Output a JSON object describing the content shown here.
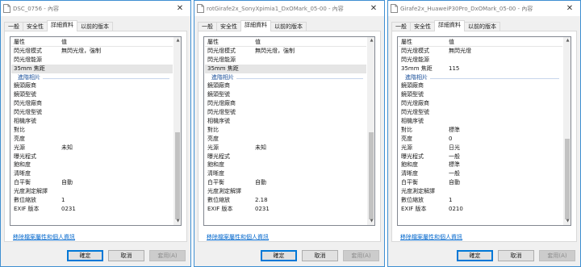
{
  "windows": [
    {
      "title": "DSC_0756 - 內容",
      "tabs": [
        "一般",
        "安全性",
        "詳細資料",
        "以前的版本"
      ],
      "active_tab": 2,
      "columns": [
        "屬性",
        "值"
      ],
      "rows_before_group": [
        {
          "k": "閃光燈模式",
          "v": "無閃光燈，強制"
        },
        {
          "k": "閃光燈能源",
          "v": ""
        },
        {
          "k": "35mm 焦距",
          "v": ""
        }
      ],
      "selected_row": 2,
      "group_label": "進階相片",
      "rows_after_group": [
        {
          "k": "鏡頭廠商",
          "v": ""
        },
        {
          "k": "鏡頭型號",
          "v": ""
        },
        {
          "k": "閃光燈廠商",
          "v": ""
        },
        {
          "k": "閃光燈型號",
          "v": ""
        },
        {
          "k": "相機序號",
          "v": ""
        },
        {
          "k": "對比",
          "v": ""
        },
        {
          "k": "亮度",
          "v": ""
        },
        {
          "k": "光源",
          "v": "未知"
        },
        {
          "k": "曝光程式",
          "v": ""
        },
        {
          "k": "飽和度",
          "v": ""
        },
        {
          "k": "清晰度",
          "v": ""
        },
        {
          "k": "白平衡",
          "v": "自動"
        },
        {
          "k": "光度測定解譯",
          "v": ""
        },
        {
          "k": "數位縮放",
          "v": "1"
        },
        {
          "k": "EXIF 版本",
          "v": "0231"
        }
      ],
      "link": "移除檔案屬性和個人資訊",
      "buttons": {
        "ok": "確定",
        "cancel": "取消",
        "apply": "套用(A)"
      }
    },
    {
      "title": "rotGirafe2x_SonyXpimia1_DxOMark_05-00 - 內容",
      "tabs": [
        "一般",
        "安全性",
        "詳細資料",
        "以前的版本"
      ],
      "active_tab": 2,
      "columns": [
        "屬性",
        "值"
      ],
      "rows_before_group": [
        {
          "k": "閃光燈模式",
          "v": "無閃光燈，強制"
        },
        {
          "k": "閃光燈能源",
          "v": ""
        },
        {
          "k": "35mm 焦距",
          "v": ""
        }
      ],
      "selected_row": 2,
      "group_label": "進階相片",
      "rows_after_group": [
        {
          "k": "鏡頭廠商",
          "v": ""
        },
        {
          "k": "鏡頭型號",
          "v": ""
        },
        {
          "k": "閃光燈廠商",
          "v": ""
        },
        {
          "k": "閃光燈型號",
          "v": ""
        },
        {
          "k": "相機序號",
          "v": ""
        },
        {
          "k": "對比",
          "v": ""
        },
        {
          "k": "亮度",
          "v": ""
        },
        {
          "k": "光源",
          "v": "未知"
        },
        {
          "k": "曝光程式",
          "v": ""
        },
        {
          "k": "飽和度",
          "v": ""
        },
        {
          "k": "清晰度",
          "v": ""
        },
        {
          "k": "白平衡",
          "v": "自動"
        },
        {
          "k": "光度測定解譯",
          "v": ""
        },
        {
          "k": "數位縮放",
          "v": "2.18"
        },
        {
          "k": "EXIF 版本",
          "v": "0231"
        }
      ],
      "link": "移除檔案屬性和個人資訊",
      "buttons": {
        "ok": "確定",
        "cancel": "取消",
        "apply": "套用(A)"
      }
    },
    {
      "title": "Girafe2x_HuaweiP30Pro_DxOMark_05-00 - 內容",
      "tabs": [
        "一般",
        "安全性",
        "詳細資料",
        "以前的版本"
      ],
      "active_tab": 2,
      "columns": [
        "屬性",
        "值"
      ],
      "rows_before_group": [
        {
          "k": "閃光燈模式",
          "v": "無閃光燈"
        },
        {
          "k": "閃光燈能源",
          "v": ""
        },
        {
          "k": "35mm 焦距",
          "v": "115"
        }
      ],
      "selected_row": -1,
      "group_label": "進階相片",
      "rows_after_group": [
        {
          "k": "鏡頭廠商",
          "v": ""
        },
        {
          "k": "鏡頭型號",
          "v": ""
        },
        {
          "k": "閃光燈廠商",
          "v": ""
        },
        {
          "k": "閃光燈型號",
          "v": ""
        },
        {
          "k": "相機序號",
          "v": ""
        },
        {
          "k": "對比",
          "v": "標準"
        },
        {
          "k": "亮度",
          "v": "0"
        },
        {
          "k": "光源",
          "v": "日光"
        },
        {
          "k": "曝光程式",
          "v": "一般"
        },
        {
          "k": "飽和度",
          "v": "標準"
        },
        {
          "k": "清晰度",
          "v": "一般"
        },
        {
          "k": "白平衡",
          "v": "自動"
        },
        {
          "k": "光度測定解譯",
          "v": ""
        },
        {
          "k": "數位縮放",
          "v": "1"
        },
        {
          "k": "EXIF 版本",
          "v": "0210"
        }
      ],
      "link": "移除檔案屬性和個人資訊",
      "buttons": {
        "ok": "確定",
        "cancel": "取消",
        "apply": "套用(A)"
      }
    }
  ]
}
